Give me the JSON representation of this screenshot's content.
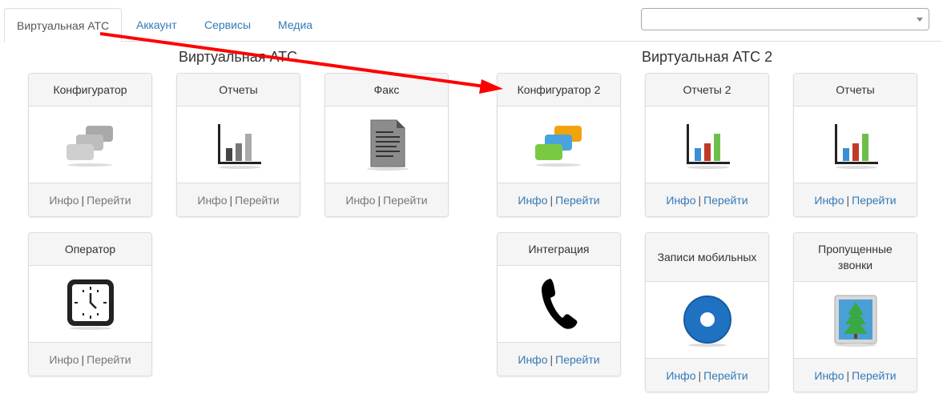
{
  "tabs": [
    {
      "label": "Виртуальная АТС",
      "active": true
    },
    {
      "label": "Аккаунт",
      "active": false
    },
    {
      "label": "Сервисы",
      "active": false
    },
    {
      "label": "Медиа",
      "active": false
    }
  ],
  "select": {
    "value": ""
  },
  "groups": [
    {
      "title": "Виртуальная АТС"
    },
    {
      "title": "Виртуальная АТС 2"
    }
  ],
  "cards": [
    {
      "title": "Конфигуратор",
      "icon": "gray-windows-icon",
      "info": "Инфо",
      "go": "Перейти"
    },
    {
      "title": "Отчеты",
      "icon": "gray-bar-chart-icon",
      "info": "Инфо",
      "go": "Перейти"
    },
    {
      "title": "Факс",
      "icon": "fax-document-icon",
      "info": "Инфо",
      "go": "Перейти"
    },
    {
      "title": "Конфигуратор 2",
      "icon": "color-windows-icon",
      "info": "Инфо",
      "go": "Перейти"
    },
    {
      "title": "Отчеты 2",
      "icon": "color-bar-chart-icon",
      "info": "Инфо",
      "go": "Перейти"
    },
    {
      "title": "Отчеты",
      "icon": "color-bar-chart-icon",
      "info": "Инфо",
      "go": "Перейти"
    },
    {
      "title": "Оператор",
      "icon": "clock-icon",
      "info": "Инфо",
      "go": "Перейти"
    },
    {
      "title": "Интеграция",
      "icon": "phone-handset-icon",
      "info": "Инфо",
      "go": "Перейти"
    },
    {
      "title": "Записи мобильных",
      "icon": "blue-disc-icon",
      "info": "Инфо",
      "go": "Перейти"
    },
    {
      "title": "Пропущенные звонки",
      "icon": "tree-picture-icon",
      "info": "Инфо",
      "go": "Перейти"
    }
  ],
  "colors": {
    "link": "#337ab7",
    "disabled_link": "#777777",
    "arrow": "#ff0000"
  }
}
